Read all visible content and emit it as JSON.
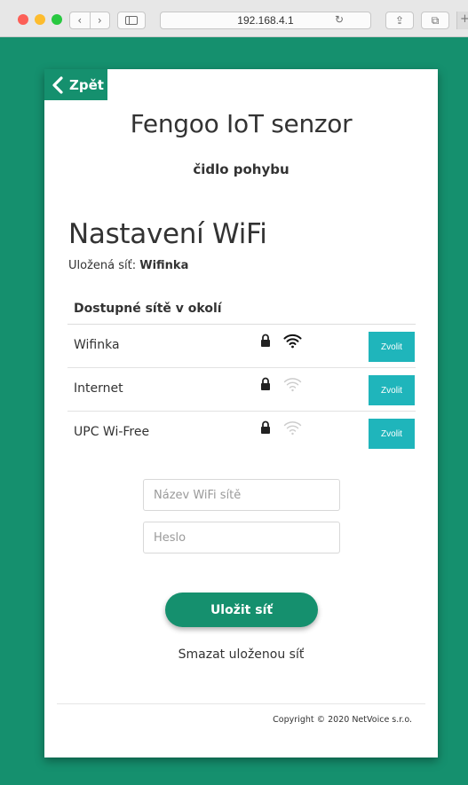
{
  "browser": {
    "address": "192.168.4.1",
    "nav_back": "‹",
    "nav_forward": "›",
    "reload": "↻",
    "share": "⇪",
    "tabs": "⧉",
    "new_tab": "+"
  },
  "header": {
    "back_label": "Zpět",
    "device_title": "Fengoo IoT senzor",
    "device_subtitle": "čidlo pohybu"
  },
  "wifi": {
    "section_title": "Nastavení WiFi",
    "saved_label": "Uložená síť:",
    "saved_value": "Wifinka",
    "table_header": "Dostupné sítě v okolí",
    "networks": [
      {
        "ssid": "Wifinka",
        "secured": true,
        "signal": 3,
        "choose_label": "Zvolit"
      },
      {
        "ssid": "Internet",
        "secured": true,
        "signal": 1,
        "choose_label": "Zvolit"
      },
      {
        "ssid": "UPC Wi-Free",
        "secured": true,
        "signal": 1,
        "choose_label": "Zvolit"
      }
    ]
  },
  "form": {
    "ssid_placeholder": "Název WiFi sítě",
    "password_placeholder": "Heslo",
    "save_label": "Uložit síť",
    "clear_label": "Smazat uloženou síť"
  },
  "footer": {
    "copyright": "Copyright © 2020 NetVoice s.r.o."
  },
  "colors": {
    "brand": "#15906e",
    "button_accent": "#1fb5bb"
  },
  "icons": {
    "back": "chevron-left-icon",
    "lock": "lock-icon",
    "wifi": "wifi-icon"
  }
}
